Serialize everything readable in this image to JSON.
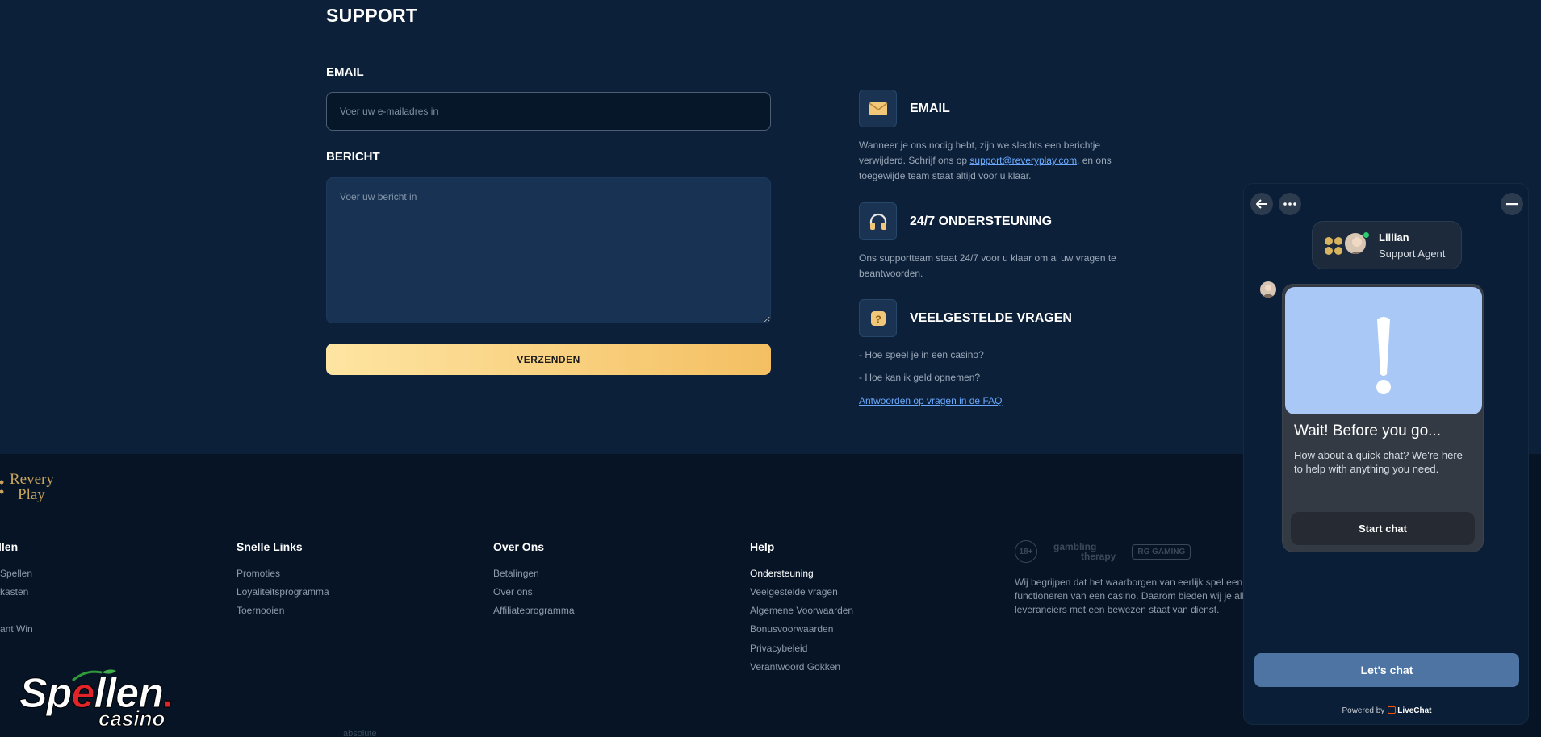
{
  "support": {
    "title": "SUPPORT",
    "email_label": "EMAIL",
    "email_placeholder": "Voer uw e-mailadres in",
    "message_label": "BERICHT",
    "message_placeholder": "Voer uw bericht in",
    "submit_label": "VERZENDEN"
  },
  "info": {
    "email": {
      "title": "EMAIL",
      "text_before": "Wanneer je ons nodig hebt, zijn we slechts een berichtje verwijderd. Schrijf ons op ",
      "link": "support@reveryplay.com",
      "text_after": ", en ons toegewijde team staat altijd voor u klaar."
    },
    "support247": {
      "title": "24/7 ONDERSTEUNING",
      "text": "Ons supportteam staat 24/7 voor u klaar om al uw vragen te beantwoorden."
    },
    "faq": {
      "title": "VEELGESTELDE VRAGEN",
      "q1": "- Hoe speel je in een casino?",
      "q2": "- Hoe kan ik geld opnemen?",
      "link": "Antwoorden op vragen in de FAQ"
    }
  },
  "footer": {
    "logo_line1": "Revery",
    "logo_line2": "Play",
    "col1": {
      "title": "llen",
      "links": [
        "Spellen",
        "kasten",
        "",
        "ant Win"
      ]
    },
    "col2": {
      "title": "Snelle Links",
      "links": [
        "Promoties",
        "Loyaliteitsprogramma",
        "Toernooien"
      ]
    },
    "col3": {
      "title": "Over Ons",
      "links": [
        "Betalingen",
        "Over ons",
        "Affiliateprogramma"
      ]
    },
    "col4": {
      "title": "Help",
      "links": [
        "Ondersteuning",
        "Veelgestelde vragen",
        "Algemene Voorwaarden",
        "Bonusvoorwaarden",
        "Privacybeleid",
        "Verantwoord Gokken"
      ]
    },
    "badges": {
      "b1": "18+",
      "b2a": "gambling",
      "b2b": "therapy",
      "b3": "RG GAMING"
    },
    "disclaimer": "Wij begrijpen dat het waarborgen van eerlijk spel een functioneren van een casino. Daarom bieden wij je alle leveranciers met een bewezen staat van dienst.",
    "strip1": "absolute"
  },
  "watermark": {
    "main_a": "Sp",
    "main_b": "e",
    "main_c": "llen",
    "dot": ".",
    "sub": "casino"
  },
  "chat": {
    "agent_name": "Lillian",
    "agent_role": "Support Agent",
    "card_title": "Wait! Before you go...",
    "card_text": "How about a quick chat? We're here to help with anything you need.",
    "start_label": "Start chat",
    "lets_chat_label": "Let's chat",
    "powered_by": "Powered by",
    "brand": "LiveChat"
  },
  "colors": {
    "accent_gold": "#f4bf62",
    "chat_button": "#4d74a3",
    "link": "#6aa9ff",
    "page_bg": "#0c2039"
  }
}
